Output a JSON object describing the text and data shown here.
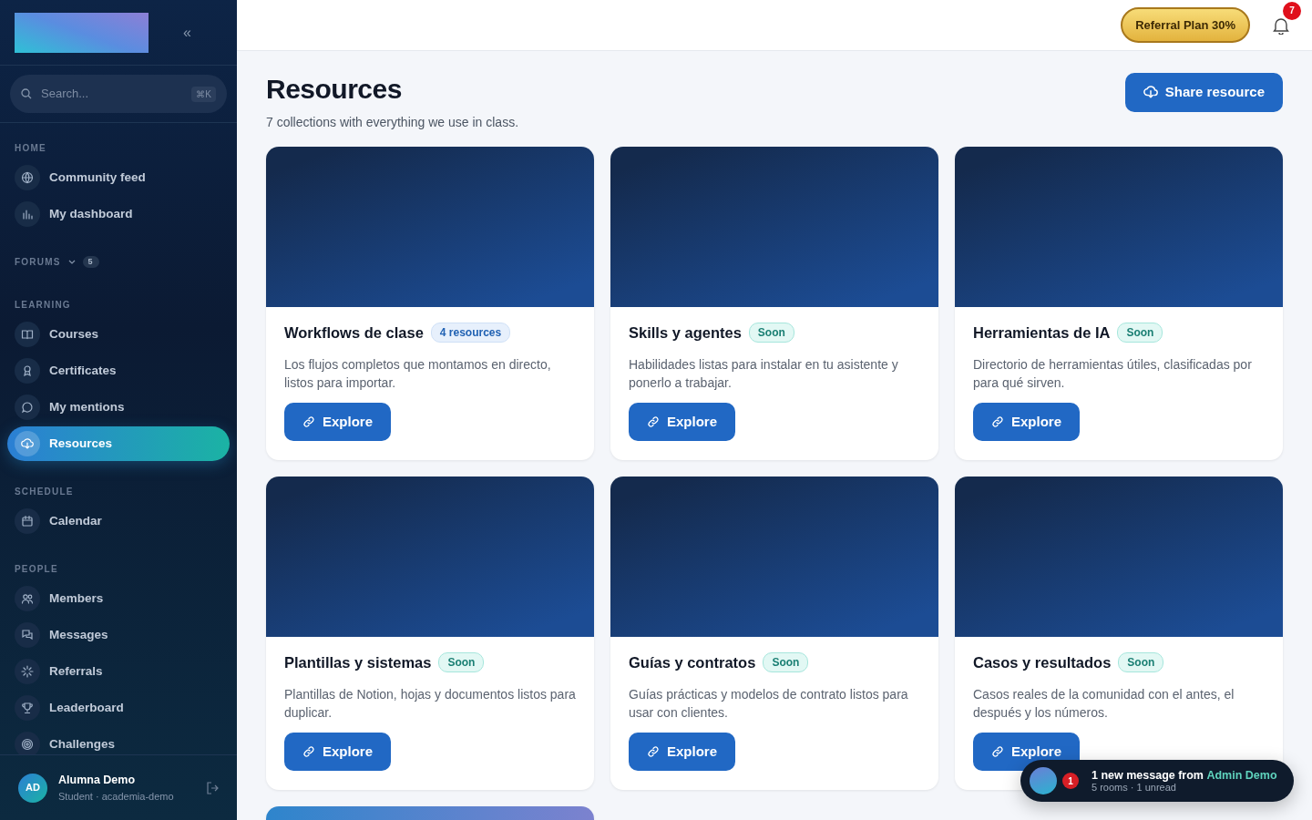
{
  "sidebar": {
    "collapse_label": "«",
    "search": {
      "placeholder": "Search...",
      "shortcut": "⌘K"
    },
    "sections": [
      {
        "label": "HOME",
        "items": [
          {
            "label": "Community feed",
            "selected": false
          },
          {
            "label": "My dashboard",
            "selected": false
          }
        ]
      },
      {
        "label": "FORUMS",
        "count": "5"
      },
      {
        "label": "LEARNING",
        "items": [
          {
            "label": "Courses",
            "selected": false
          },
          {
            "label": "Certificates",
            "selected": false
          },
          {
            "label": "My mentions",
            "selected": false
          },
          {
            "label": "Resources",
            "selected": true
          }
        ]
      },
      {
        "label": "SCHEDULE",
        "items": [
          {
            "label": "Calendar",
            "selected": false
          }
        ]
      },
      {
        "label": "PEOPLE",
        "items": [
          {
            "label": "Members",
            "selected": false
          },
          {
            "label": "Messages",
            "selected": false
          },
          {
            "label": "Referrals",
            "selected": false
          },
          {
            "label": "Leaderboard",
            "selected": false
          },
          {
            "label": "Challenges",
            "selected": false
          }
        ]
      }
    ],
    "user": {
      "initials": "AD",
      "name": "Alumna Demo",
      "role": "Student · academia-demo"
    }
  },
  "topbar": {
    "referral": "Referral Plan 30%",
    "notifications": "7"
  },
  "page": {
    "title": "Resources",
    "subtitle": "7 collections with everything we use in class.",
    "action": "Share resource"
  },
  "cards": [
    {
      "kind": "collection",
      "title": "Workflows de clase",
      "badge": {
        "kind": "count",
        "text": "4 resources"
      },
      "description": "Los flujos completos que montamos en directo, listos para importar.",
      "button": "Explore"
    },
    {
      "kind": "collection",
      "title": "Skills y agentes",
      "badge": {
        "kind": "soon",
        "text": "Soon"
      },
      "description": "Habilidades listas para instalar en tu asistente y ponerlo a trabajar.",
      "button": "Explore"
    },
    {
      "kind": "collection",
      "title": "Herramientas de IA",
      "badge": {
        "kind": "soon",
        "text": "Soon"
      },
      "description": "Directorio de herramientas útiles, clasificadas por para qué sirven.",
      "button": "Explore"
    },
    {
      "kind": "collection",
      "title": "Plantillas y sistemas",
      "badge": {
        "kind": "soon",
        "text": "Soon"
      },
      "description": "Plantillas de Notion, hojas y documentos listos para duplicar.",
      "button": "Explore"
    },
    {
      "kind": "collection",
      "title": "Guías y contratos",
      "badge": {
        "kind": "soon",
        "text": "Soon"
      },
      "description": "Guías prácticas y modelos de contrato listos para usar con clientes.",
      "button": "Explore"
    },
    {
      "kind": "collection",
      "title": "Casos y resultados",
      "badge": {
        "kind": "soon",
        "text": "Soon"
      },
      "description": "Casos reales de la comunidad con el antes, el después y los números.",
      "button": "Explore"
    },
    {
      "kind": "featured"
    }
  ],
  "toast": {
    "count": "1",
    "text": "1 new message from ",
    "sender": "Admin Demo",
    "detail": "5 rooms · 1 unread"
  }
}
